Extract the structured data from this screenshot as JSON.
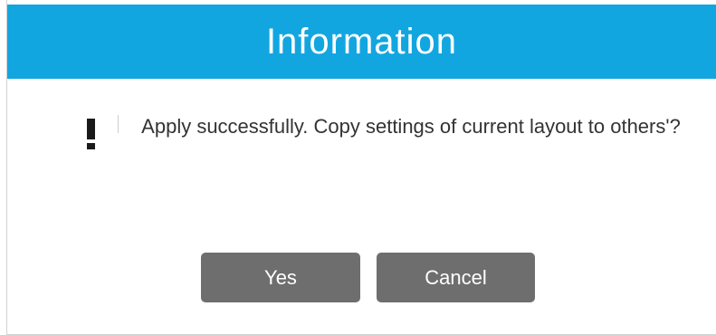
{
  "dialog": {
    "title": "Information",
    "icon": "exclamation-icon",
    "message": "Apply successfully. Copy settings of current layout to others'?",
    "buttons": {
      "yes_label": "Yes",
      "cancel_label": "Cancel"
    },
    "colors": {
      "title_bar": "#12a6e0",
      "button": "#6e6e6e"
    }
  }
}
